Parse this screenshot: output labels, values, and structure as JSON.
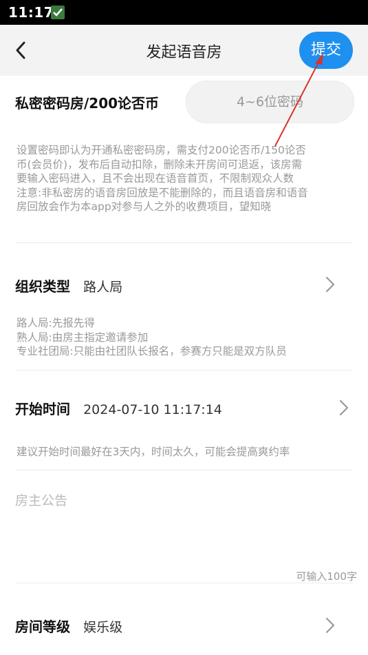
{
  "status_bar": {
    "time": "11:17"
  },
  "header": {
    "title": "发起语音房",
    "submit_label": "提交"
  },
  "private_room": {
    "label": "私密密码房/200论否币",
    "password_placeholder": "4~6位密码",
    "hint_lines": [
      "设置密码即认为开通私密密码房，需支付200论否币/150论否",
      "币(会员价)，发布后自动扣除，删除未开房间可退返，该房需",
      "要输入密码进入，且不会出现在语音首页，不限制观众人数",
      "注意:非私密房的语音房回放是不能删除的，而且语音房和语音",
      "房回放会作为本app对参与人之外的收费项目，望知晓"
    ]
  },
  "org_type": {
    "label": "组织类型",
    "value": "路人局",
    "hint_lines": [
      "路人局:先报先得",
      "熟人局:由房主指定邀请参加",
      "专业社团局:只能由社团队长报名，参赛方只能是双方队员"
    ]
  },
  "start_time": {
    "label": "开始时间",
    "value": "2024-07-10 11:17:14",
    "hint": "建议开始时间最好在3天内，时间太久，可能会提高爽约率"
  },
  "announcement": {
    "placeholder": "房主公告",
    "counter": "可输入100字"
  },
  "room_level": {
    "label": "房间等级",
    "value": "娱乐级"
  },
  "colors": {
    "accent": "#1e90f0",
    "annotation_arrow": "#d9342b"
  }
}
